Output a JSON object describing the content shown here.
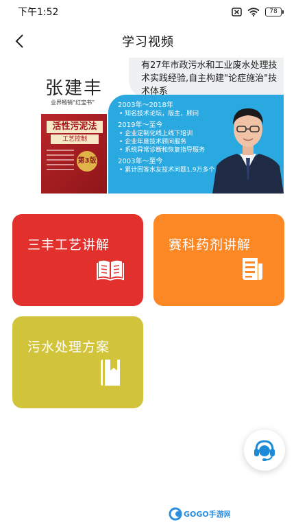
{
  "status_bar": {
    "time": "下午1:52",
    "battery": "78"
  },
  "header": {
    "title": "学习视频"
  },
  "banner": {
    "top_text": "有27年市政污水和工业废水处理技术实践经验,自主构建\"论症施治\"技术体系",
    "name": "张建丰",
    "subtitle": "业界畅销“红宝书”",
    "book_title": "活性污泥法",
    "book_subtitle": "工艺控制",
    "book_badge": "第3版",
    "timeline": [
      {
        "period": "2003年～2018年",
        "items": [
          "• 知名技术论坛，版主，顾问"
        ]
      },
      {
        "period": "2019年～至今",
        "items": [
          "• 企业定制化线上线下培训",
          "• 企业年度技术顾问服务",
          "• 系统异常诊断和恢复指导服务"
        ]
      },
      {
        "period": "2003年～至今",
        "items": [
          "• 累计回答水友技术问题1.9万多个"
        ]
      }
    ]
  },
  "cards": [
    {
      "label": "三丰工艺讲解",
      "color": "#e2302d",
      "icon": "open-book-icon"
    },
    {
      "label": "赛科药剂讲解",
      "color": "#fb8725",
      "icon": "document-icon"
    },
    {
      "label": "污水处理方案",
      "color": "#d2c43a",
      "icon": "bookmark-book-icon"
    }
  ],
  "service": {
    "icon": "customer-service-icon"
  },
  "watermark": {
    "text": "GOGO手游网"
  }
}
